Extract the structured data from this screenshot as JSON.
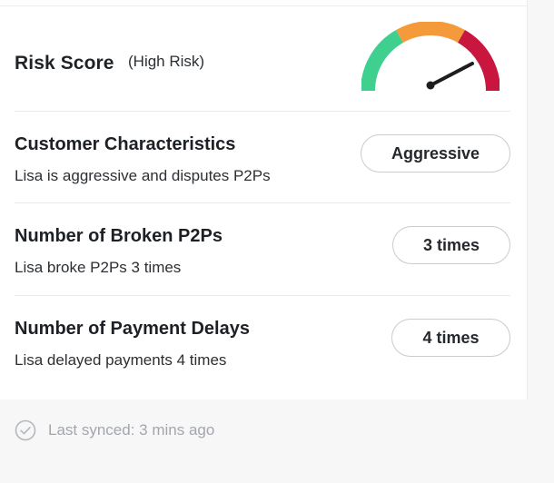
{
  "risk": {
    "label": "Risk Score",
    "level": "(High Risk)",
    "gauge_colors": [
      "#3fcf8e",
      "#f59a3a",
      "#c8163f"
    ],
    "needle_color": "#1d1d1f"
  },
  "items": [
    {
      "title": "Customer Characteristics",
      "description": "Lisa is aggressive and disputes P2Ps",
      "badge": "Aggressive"
    },
    {
      "title": "Number of Broken P2Ps",
      "description": "Lisa broke P2Ps 3 times",
      "badge": "3 times"
    },
    {
      "title": "Number of Payment Delays",
      "description": "Lisa delayed payments 4 times",
      "badge": "4 times"
    }
  ],
  "footer": {
    "sync_text": "Last synced: 3 mins ago",
    "icon": "check-circle-icon"
  }
}
